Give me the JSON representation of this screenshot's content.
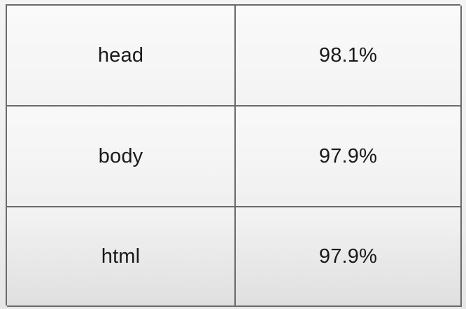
{
  "table": {
    "rows": [
      {
        "name": "head",
        "value": "98.1%"
      },
      {
        "name": "body",
        "value": "97.9%"
      },
      {
        "name": "html",
        "value": "97.9%"
      }
    ]
  }
}
